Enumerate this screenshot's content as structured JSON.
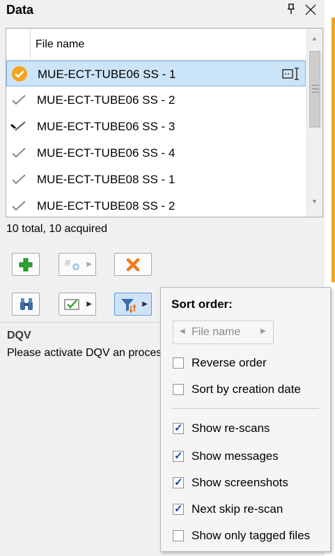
{
  "panel": {
    "title": "Data",
    "pin_glyph": "⊕",
    "close_glyph": "✕"
  },
  "list": {
    "column_header": "File name",
    "rows": [
      {
        "name": "MUE-ECT-TUBE06 SS - 1",
        "status": "current",
        "selected": true
      },
      {
        "name": "MUE-ECT-TUBE06 SS - 2",
        "status": "acquired",
        "selected": false
      },
      {
        "name": "MUE-ECT-TUBE06 SS - 3",
        "status": "acquired-marked",
        "selected": false
      },
      {
        "name": "MUE-ECT-TUBE06 SS - 4",
        "status": "acquired",
        "selected": false
      },
      {
        "name": "MUE-ECT-TUBE08 SS - 1",
        "status": "acquired",
        "selected": false
      },
      {
        "name": "MUE-ECT-TUBE08 SS - 2",
        "status": "acquired",
        "selected": false
      }
    ]
  },
  "status_text": "10 total, 10 acquired",
  "toolbar": {
    "add_icon": "plus-icon",
    "number_icon": "add-number-icon",
    "delete_icon": "delete-x-icon",
    "find_icon": "binoculars-icon",
    "check_icon": "checklist-icon",
    "sort_icon": "sort-filter-icon"
  },
  "dqv": {
    "heading": "DQV",
    "message": "Please activate DQV an process."
  },
  "sort_popup": {
    "title": "Sort order:",
    "sort_field": "File name",
    "options": [
      {
        "label": "Reverse order",
        "checked": false
      },
      {
        "label": "Sort by creation date",
        "checked": false
      },
      {
        "label": "Show re-scans",
        "checked": true
      },
      {
        "label": "Show messages",
        "checked": true
      },
      {
        "label": "Show screenshots",
        "checked": true
      },
      {
        "label": "Next skip re-scan",
        "checked": true
      },
      {
        "label": "Show only tagged files",
        "checked": false
      }
    ]
  },
  "colors": {
    "accent_orange": "#f4a41b",
    "selection": "#cce4f7",
    "check_blue": "#1f3fae",
    "add_green": "#2ea32e",
    "delete_orange": "#f07a1a"
  }
}
